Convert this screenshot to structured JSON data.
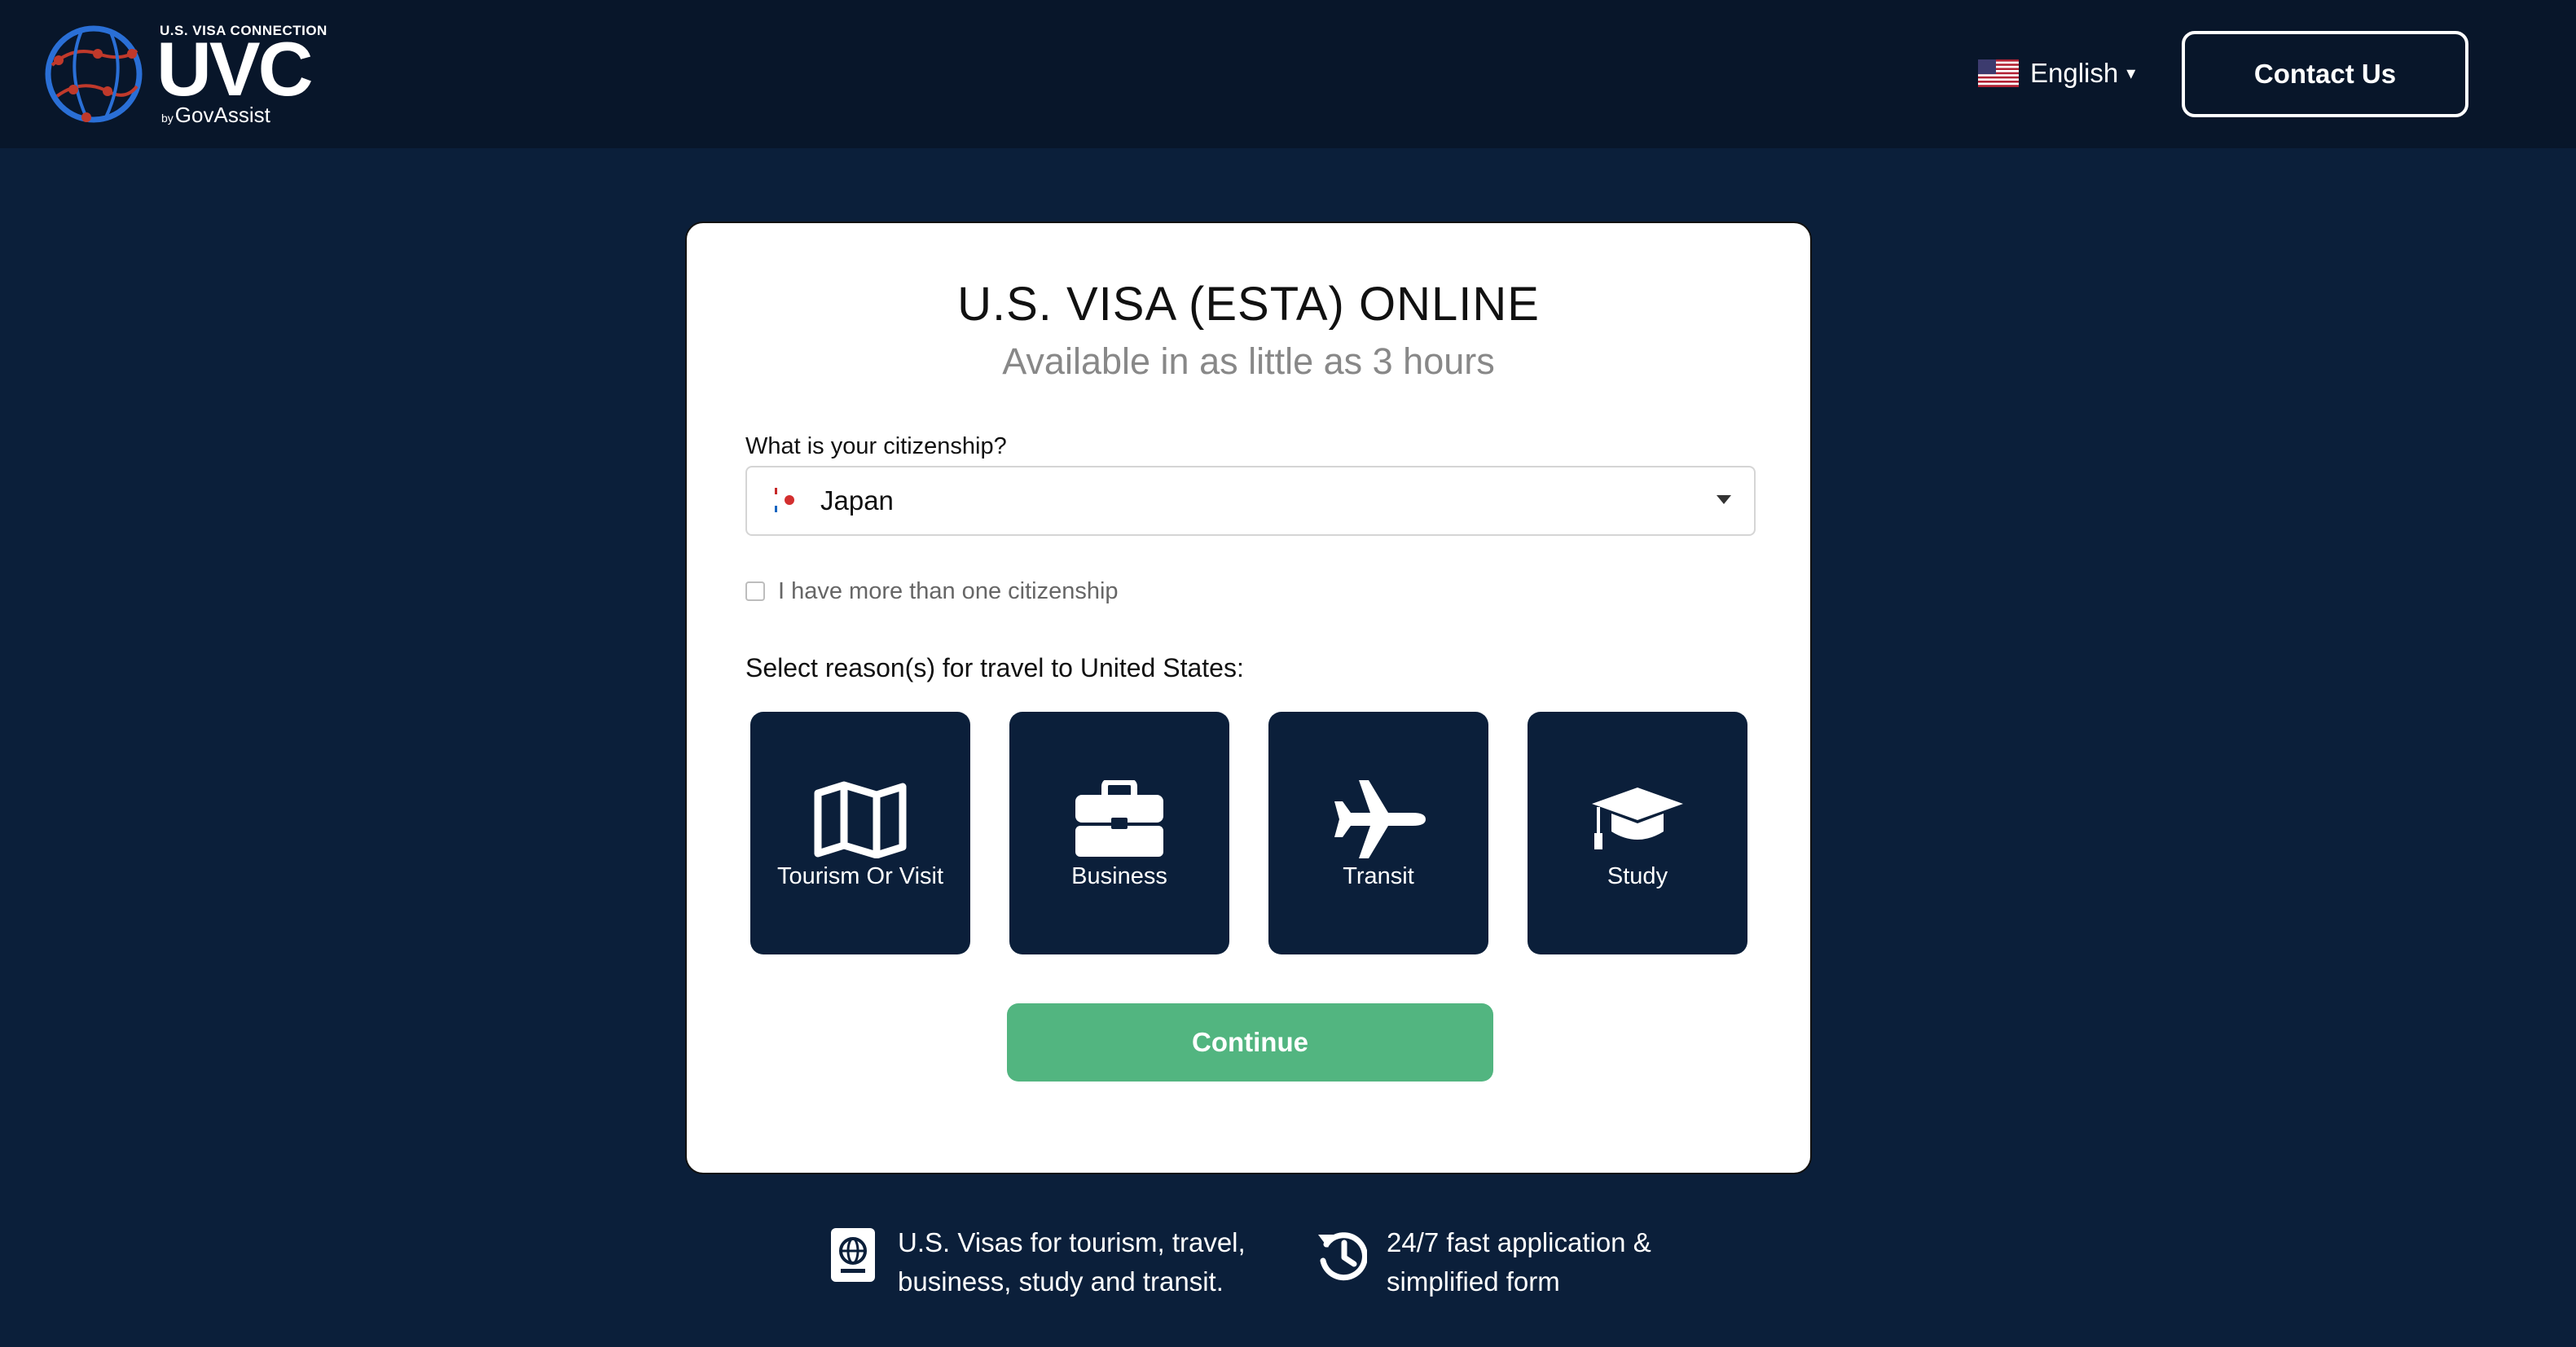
{
  "header": {
    "logo_small_text": "U.S. VISA CONNECTION",
    "logo_big_text": "UVC",
    "logo_by": "by",
    "logo_brand": "GovAssist",
    "language_label": "English",
    "language_caret": "▾",
    "contact_button": "Contact Us"
  },
  "card": {
    "title": "U.S. VISA (ESTA) ONLINE",
    "subtitle": "Available in as little as 3 hours",
    "citizenship_label": "What is your citizenship?",
    "citizenship_value": "Japan",
    "multiple_citizenship_label": "I have more than one citizenship",
    "multiple_citizenship_checked": false,
    "reasons_label": "Select reason(s) for travel to United States:",
    "reasons": [
      {
        "label": "Tourism Or Visit",
        "icon": "map-icon"
      },
      {
        "label": "Business",
        "icon": "briefcase-icon"
      },
      {
        "label": "Transit",
        "icon": "airplane-icon"
      },
      {
        "label": "Study",
        "icon": "graduation-cap-icon"
      }
    ],
    "continue_button": "Continue"
  },
  "features": [
    {
      "icon": "passport-icon",
      "line1": "U.S. Visas for tourism, travel,",
      "line2": "business, study and transit."
    },
    {
      "icon": "history-clock-icon",
      "line1": "24/7 fast application &",
      "line2": "simplified form"
    }
  ],
  "colors": {
    "background": "#0b1f3a",
    "header_background": "#08162a",
    "tile_background": "#0b1f3a",
    "continue_green": "#52b580",
    "subtitle_gray": "#888888"
  }
}
